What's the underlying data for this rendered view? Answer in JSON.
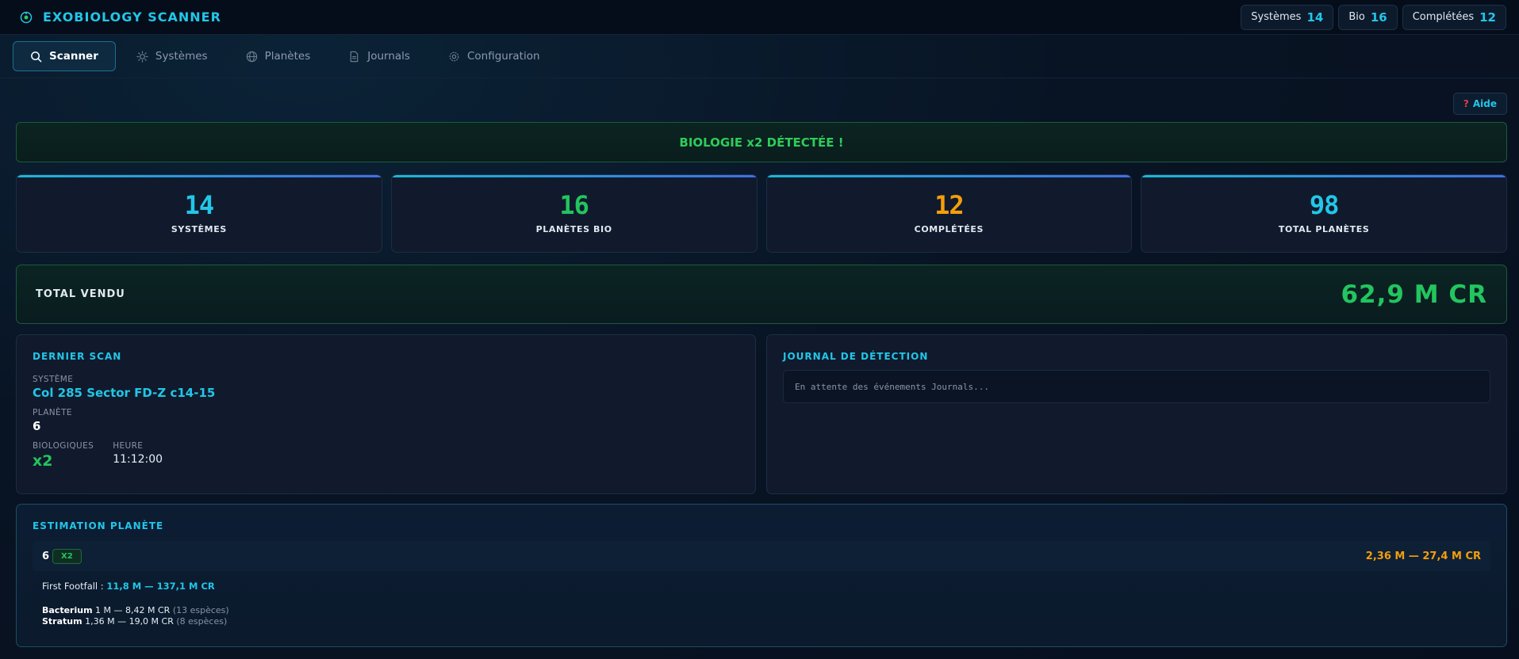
{
  "header": {
    "title": "EXOBIOLOGY SCANNER",
    "stats": [
      {
        "label": "Systèmes",
        "value": "14"
      },
      {
        "label": "Bio",
        "value": "16"
      },
      {
        "label": "Complétées",
        "value": "12"
      }
    ]
  },
  "nav": {
    "tabs": [
      {
        "label": "Scanner",
        "icon": "search-icon"
      },
      {
        "label": "Systèmes",
        "icon": "sun-icon"
      },
      {
        "label": "Planètes",
        "icon": "globe-icon"
      },
      {
        "label": "Journals",
        "icon": "document-icon"
      },
      {
        "label": "Configuration",
        "icon": "gear-icon"
      }
    ]
  },
  "help_label": "Aide",
  "alert": "BIOLOGIE x2 DÉTECTÉE !",
  "cards": [
    {
      "value": "14",
      "label": "SYSTÈMES",
      "color": "#22c6e8"
    },
    {
      "value": "16",
      "label": "PLANÈTES BIO",
      "color": "#22c55e"
    },
    {
      "value": "12",
      "label": "COMPLÉTÉES",
      "color": "#f59e0b"
    },
    {
      "value": "98",
      "label": "TOTAL PLANÈTES",
      "color": "#22c6e8"
    }
  ],
  "total": {
    "label": "TOTAL VENDU",
    "value": "62,9 M CR"
  },
  "last_scan": {
    "title": "DERNIER SCAN",
    "system_label": "SYSTÈME",
    "system": "Col 285 Sector FD-Z c14-15",
    "planet_label": "PLANÈTE",
    "planet": "6",
    "bio_label": "BIOLOGIQUES",
    "bio": "x2",
    "time_label": "HEURE",
    "time": "11:12:00"
  },
  "journal": {
    "title": "JOURNAL DE DÉTECTION",
    "waiting": "En attente des événements Journals..."
  },
  "estimation": {
    "title": "ESTIMATION PLANÈTE",
    "planet": "6",
    "badge": "X2",
    "range": "2,36 M — 27,4 M CR",
    "first_footfall_label": "First Footfall :",
    "first_footfall_value": "11,8 M — 137,1 M CR",
    "species": [
      {
        "name": "Bacterium",
        "range": "1 M — 8,42 M CR",
        "count": "(13 espèces)"
      },
      {
        "name": "Stratum",
        "range": "1,36 M — 19,0 M CR",
        "count": "(8 espèces)"
      }
    ]
  }
}
